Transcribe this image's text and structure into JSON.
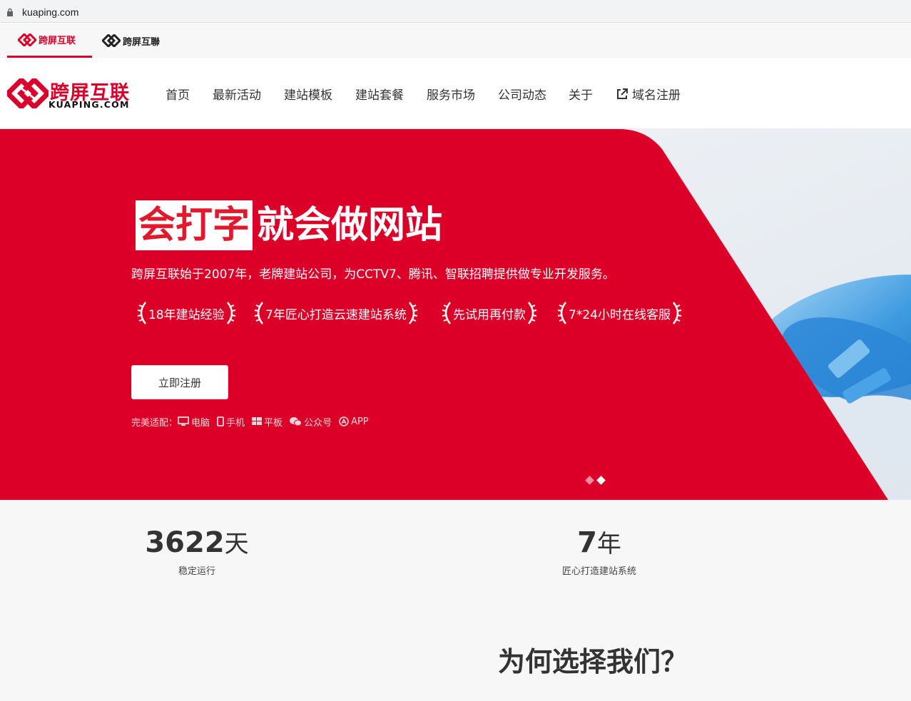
{
  "browser": {
    "url": "kuaping.com"
  },
  "brand_tabs": [
    {
      "label": "跨屏互联",
      "active": true
    },
    {
      "label": "跨屏互聯",
      "active": false
    }
  ],
  "logo": {
    "cn": "跨屏互联",
    "en": "KUAPING.COM"
  },
  "nav": [
    "首页",
    "最新活动",
    "建站模板",
    "建站套餐",
    "服务市场",
    "公司动态",
    "关于",
    "域名注册"
  ],
  "hero": {
    "headline_highlight": "会打字",
    "headline_rest": "就会做网站",
    "subline": "跨屏互联始于2007年，老牌建站公司，为CCTV7、腾讯、智联招聘提供做专业开发服务。",
    "badges": [
      "18年建站经验",
      "7年匠心打造云速建站系统",
      "先试用再付款",
      "7*24小时在线客服"
    ],
    "register_button": "立即注册",
    "adapt_label": "完美适配：",
    "adapt_items": [
      "电脑",
      "手机",
      "平板",
      "公众号",
      "APP"
    ],
    "slide_count": 2,
    "active_slide": 2
  },
  "stats": [
    {
      "value": "3622",
      "unit": "天",
      "label": "稳定运行"
    },
    {
      "value": "7",
      "unit": "年",
      "label": "匠心打造建站系统"
    }
  ],
  "section_title": "为何选择我们？",
  "colors": {
    "brand_red": "#d9002b",
    "hero_red": "#dc0029"
  }
}
